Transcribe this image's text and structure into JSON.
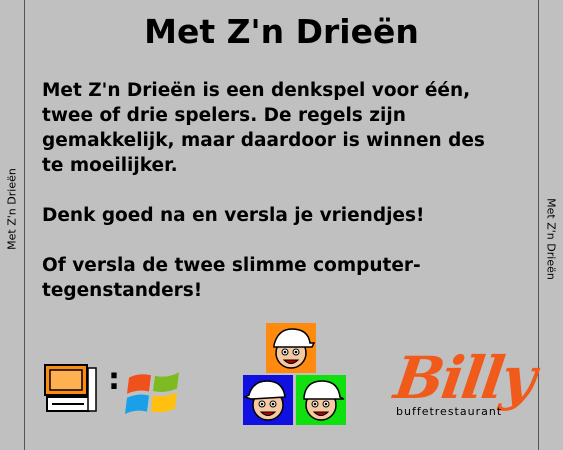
{
  "spine": {
    "text": "Met Z'n Drieën"
  },
  "title": "Met Z'n Drieën",
  "paragraphs": [
    "Met Z'n Drieën is een denkspel voor één, twee of drie spelers. De regels zijn gemakkelijk, maar daardoor is winnen des te moeilijker.",
    "Denk goed na en versla je vriendjes!",
    "Of versla de twee slimme computer-tegenstanders!"
  ],
  "platform": {
    "separator": ":"
  },
  "logo": {
    "word": "Billy",
    "subtitle": "buffetrestaurant"
  },
  "icons": [
    "computer-icon",
    "windows-logo-icon",
    "boy-face-icon"
  ],
  "colors": {
    "background": "#c0c0c0",
    "face_top": "#ff8a10",
    "face_left": "#1010e0",
    "face_right": "#10e010",
    "logo": "#f05a1a"
  }
}
